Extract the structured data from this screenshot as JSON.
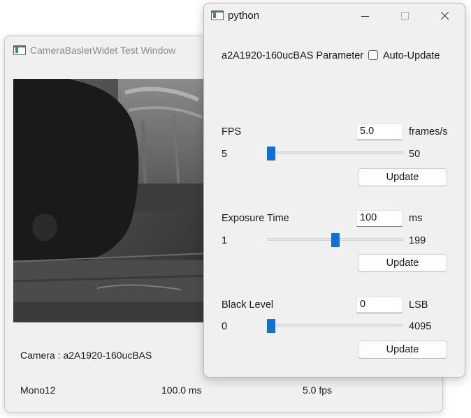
{
  "back_window": {
    "title": "CameraBaslerWidet Test Window",
    "camera_label": "Camera : a2A1920-160ucBAS",
    "pixel_format": "Mono12",
    "exposure_readout": "100.0 ms",
    "fps_readout": "5.0 fps"
  },
  "front_window": {
    "title": "python",
    "header_label": "a2A1920-160ucBAS Parameter",
    "auto_update_label": "Auto-Update",
    "auto_update_checked": false,
    "params": [
      {
        "label": "FPS",
        "value": "5.0",
        "unit": "frames/s",
        "min": "5",
        "max": "50",
        "slider_fraction": 0.0,
        "button": "Update"
      },
      {
        "label": "Exposure Time",
        "value": "100",
        "unit": "ms",
        "min": "1",
        "max": "199",
        "slider_fraction": 0.5,
        "button": "Update"
      },
      {
        "label": "Black Level",
        "value": "0",
        "unit": "LSB",
        "min": "0",
        "max": "4095",
        "slider_fraction": 0.0,
        "button": "Update"
      }
    ]
  },
  "colors": {
    "accent": "#1170d6",
    "window_bg": "#f0f0f0"
  },
  "icons": [
    "app-window-icon",
    "minimize-icon",
    "maximize-icon",
    "close-icon"
  ]
}
